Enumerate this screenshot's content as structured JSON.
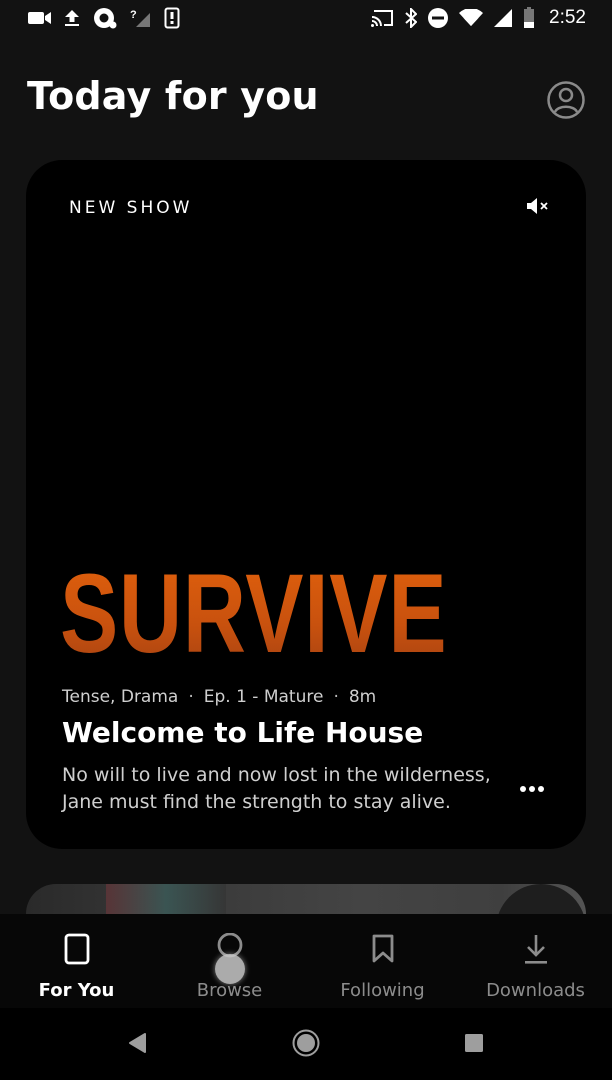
{
  "status_bar": {
    "left_icons": [
      "video-camera-icon",
      "upload-icon",
      "messaging-app-icon",
      "no-signal-icon",
      "device-alert-icon"
    ],
    "right_icons": [
      "cast-icon",
      "bluetooth-icon",
      "do-not-disturb-icon",
      "wifi-icon",
      "cellular-signal-icon",
      "battery-icon"
    ],
    "time": "2:52"
  },
  "header": {
    "title": "Today for you",
    "profile_icon": "account-circle-icon"
  },
  "feature_card": {
    "badge": "NEW SHOW",
    "mute_icon": "volume-muted-icon",
    "show_logo": "SURVIVE",
    "meta": {
      "genres": "Tense, Drama",
      "episode": "Ep. 1 - Mature",
      "duration": "8m",
      "separator": "·"
    },
    "episode_title": "Welcome to Life House",
    "description": "No will to live and now lost in the wilderness, Jane must find the strength to stay alive.",
    "more_icon": "more-horizontal-icon",
    "logo_color": "#d9580e"
  },
  "tab_bar": {
    "tabs": [
      {
        "label": "For You",
        "icon": "card-icon",
        "active": true
      },
      {
        "label": "Browse",
        "icon": "search-icon",
        "active": false
      },
      {
        "label": "Following",
        "icon": "bookmark-icon",
        "active": false
      },
      {
        "label": "Downloads",
        "icon": "download-icon",
        "active": false
      }
    ]
  },
  "nav_bar": {
    "buttons": [
      "back-icon",
      "home-icon",
      "recents-icon"
    ]
  }
}
